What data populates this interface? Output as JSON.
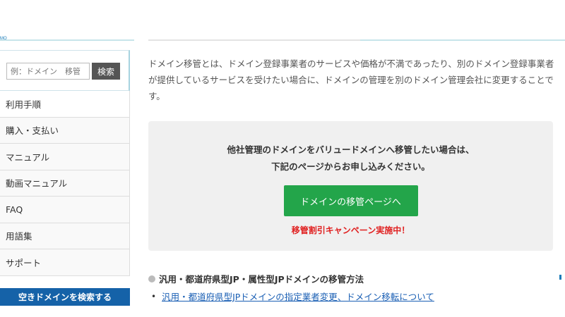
{
  "header": {
    "logo_text": "MO"
  },
  "sidebar": {
    "search_placeholder": "例：ドメイン　移管",
    "search_button": "検索",
    "menu_items": [
      {
        "label": "利用手順"
      },
      {
        "label": "購入・支払い"
      },
      {
        "label": "マニュアル"
      },
      {
        "label": "動画マニュアル"
      },
      {
        "label": "FAQ"
      },
      {
        "label": "用語集"
      },
      {
        "label": "サポート"
      }
    ],
    "cta_label": "空きドメインを検索する"
  },
  "main": {
    "intro_text": "ドメイン移管とは、ドメイン登録事業者のサービスや価格が不満であったり、別のドメイン登録事業者が提供しているサービスを受けたい場合に、ドメインの管理を別のドメイン管理会社に変更することです。",
    "box_line1": "他社管理のドメインをバリュードメインへ移管したい場合は、",
    "box_line2": "下記のページからお申し込みください。",
    "transfer_button": "ドメインの移管ページへ",
    "campaign_text": "移管割引キャンペーン実施中！",
    "section_title": "汎用・都道府県型JP・属性型JPドメインの移管方法",
    "link_text": "汎用・都道府県型JPドメインの指定業者変更、ドメイン移転について"
  },
  "colors": {
    "accent_green": "#23a54a",
    "cta_blue": "#1562a8",
    "campaign_red": "#e02020",
    "link_blue": "#1a5fb4"
  }
}
